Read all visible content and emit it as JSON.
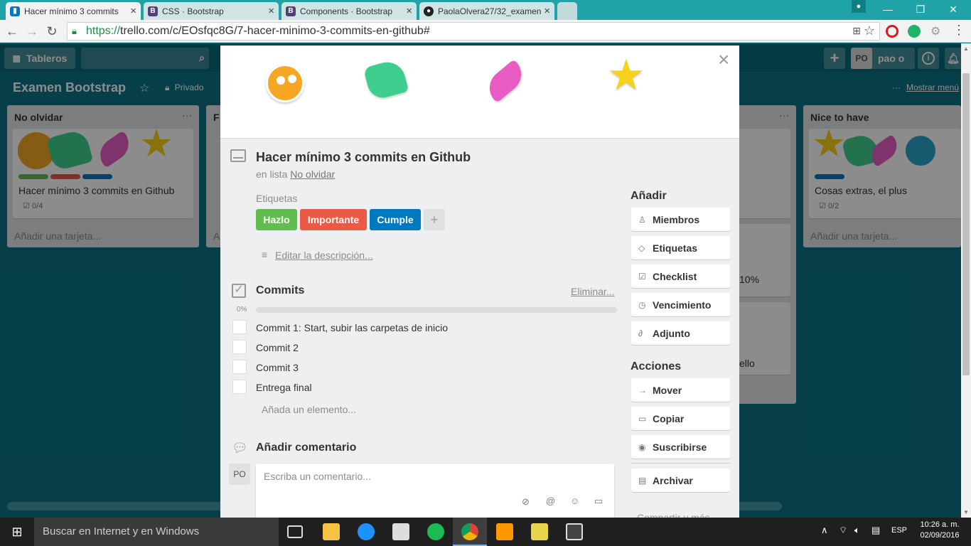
{
  "browser": {
    "tabs": [
      {
        "title": "Hacer mínimo 3 commits",
        "favicon": "trello-icon",
        "active": true
      },
      {
        "title": "CSS · Bootstrap",
        "favicon": "bootstrap-icon",
        "active": false
      },
      {
        "title": "Components · Bootstrap",
        "favicon": "bootstrap-icon",
        "active": false
      },
      {
        "title": "PaolaOlvera27/32_examen",
        "favicon": "github-icon",
        "active": false
      }
    ],
    "close_glyph": "×",
    "url_scheme": "https://",
    "url_rest": "trello.com/c/EOsfqc8G/7-hacer-minimo-3-commits-en-github#",
    "window": {
      "min": "—",
      "restore": "❐",
      "close": "✕"
    }
  },
  "header": {
    "boards_label": "Tableros",
    "search_placeholder": "",
    "add_glyph": "+",
    "avatar_initials": "PO",
    "username": "pao o",
    "info_glyph": "i"
  },
  "board": {
    "title": "Examen Bootstrap",
    "visibility": "Privado",
    "show_menu": "Mostrar menú",
    "lists": [
      {
        "title": "No olvidar",
        "card_title": "Hacer mínimo 3 commits en Github",
        "checklist": "0/4",
        "add_card": "Añadir una tarjeta..."
      },
      {
        "title": "F",
        "add_card": "A"
      },
      {
        "title": "Nice to have",
        "card_title": "Cosas extras, el plus",
        "checklist": "0/2",
        "add_card": "Añadir una tarjeta..."
      }
    ],
    "partial_texts": {
      "percent": "10%",
      "trello": "ello"
    }
  },
  "modal": {
    "close_glyph": "×",
    "title": "Hacer mínimo 3 commits en Github",
    "in_list_prefix": "en lista",
    "in_list_name": "No olvidar",
    "labels_heading": "Etiquetas",
    "labels": [
      {
        "text": "Hazlo",
        "color": "#61bd4f"
      },
      {
        "text": "Importante",
        "color": "#eb5a46"
      },
      {
        "text": "Cumple",
        "color": "#0079bf"
      }
    ],
    "add_label_glyph": "+",
    "edit_description": "Editar la descripción...",
    "checklist": {
      "title": "Commits",
      "delete": "Eliminar...",
      "progress_label": "0%",
      "progress": 0,
      "items": [
        "Commit 1: Start, subir las carpetas de inicio",
        "Commit 2",
        "Commit 3",
        "Entrega final"
      ],
      "add_item": "Añada un elemento..."
    },
    "comment": {
      "title": "Añadir comentario",
      "avatar": "PO",
      "placeholder": "Escriba un comentario..."
    },
    "sidebar": {
      "add_heading": "Añadir",
      "add_buttons": [
        "Miembros",
        "Etiquetas",
        "Checklist",
        "Vencimiento",
        "Adjunto"
      ],
      "actions_heading": "Acciones",
      "action_buttons": [
        "Mover",
        "Copiar",
        "Suscribirse",
        "Archivar"
      ],
      "share": "Compartir y más..."
    }
  },
  "taskbar": {
    "search_placeholder": "Buscar en Internet y en Windows",
    "language": "ESP",
    "time": "10:26 a. m.",
    "date": "02/09/2016"
  },
  "colors": {
    "board_bg": "#0b7487",
    "label_green": "#61bd4f",
    "label_red": "#eb5a46",
    "label_blue": "#0079bf",
    "sticker_orange": "#f5a623",
    "sticker_green": "#3ecf8e",
    "sticker_pink": "#e85cc4",
    "sticker_yellow": "#f6d21b"
  }
}
